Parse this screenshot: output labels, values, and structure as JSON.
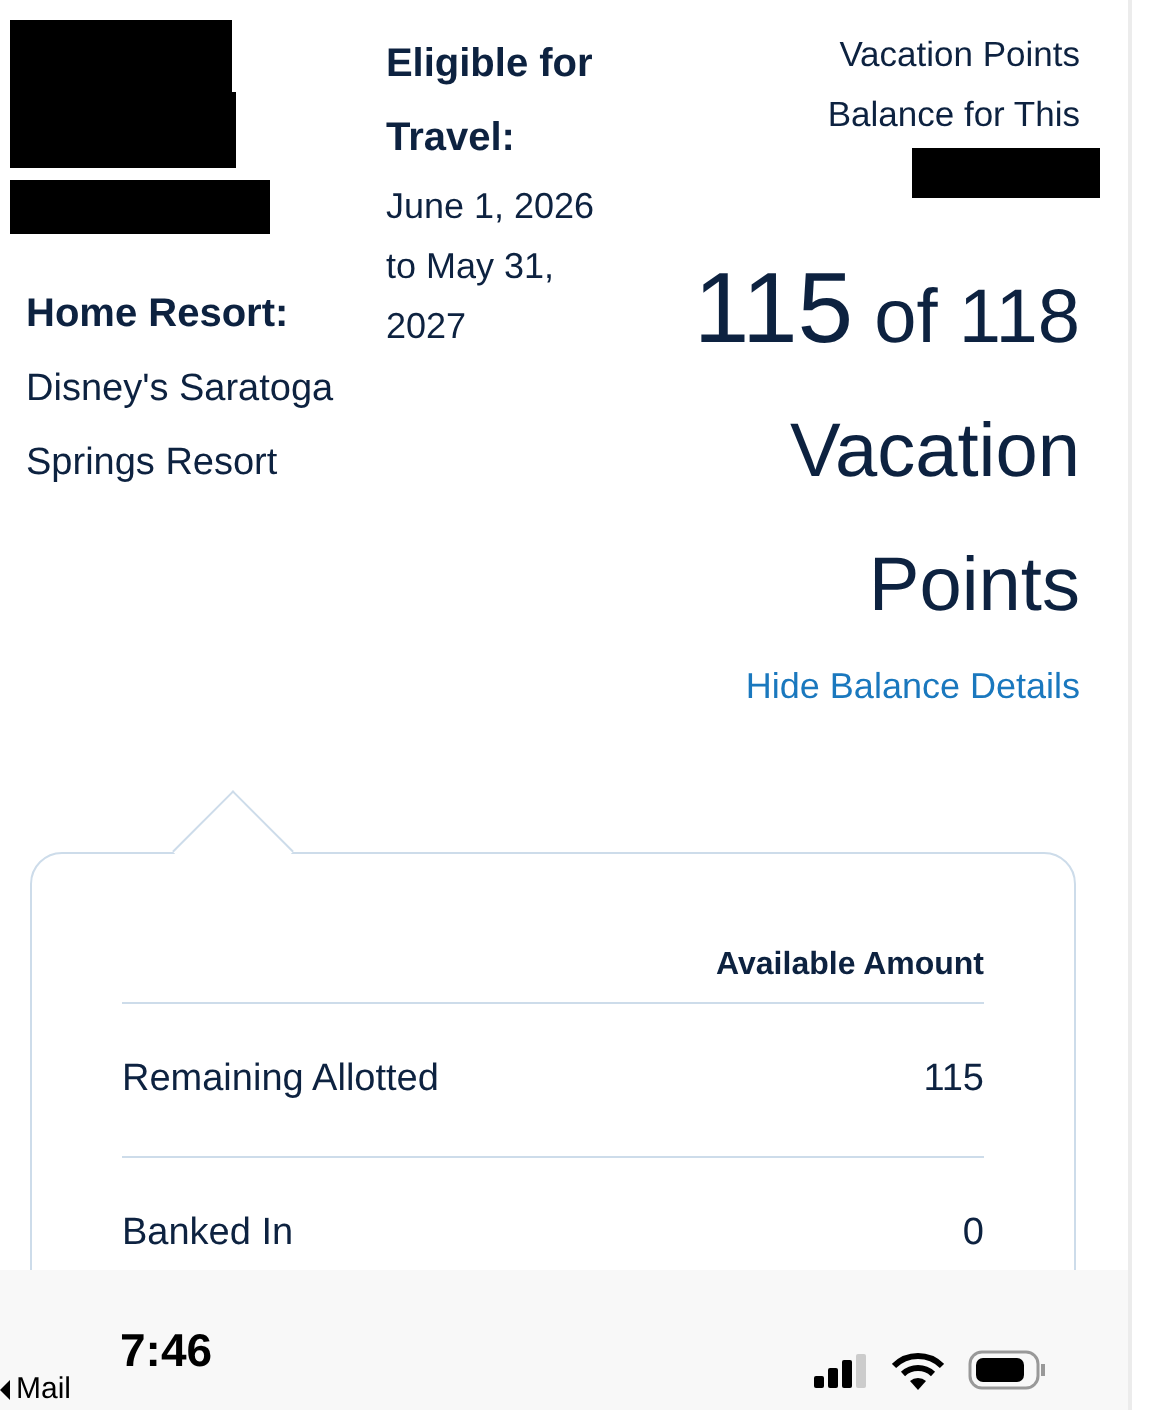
{
  "summary": {
    "home_resort": {
      "label": "Home Resort:",
      "value": "Disney's Saratoga Springs Resort"
    },
    "eligibility": {
      "label": "Eligible for Travel:",
      "dates": "June 1, 2026 to May 31, 2027"
    },
    "balance": {
      "caption": "Vacation Points Balance for This",
      "current": "115",
      "rest": "of 118 Vacation Points"
    },
    "toggle_link": "Hide Balance Details"
  },
  "details": {
    "columns": [
      "Available Amount"
    ],
    "rows": [
      {
        "label": "Remaining Allotted",
        "amount": "115"
      },
      {
        "label": "Banked In",
        "amount": "0"
      }
    ]
  },
  "status_bar": {
    "back_app": "Mail",
    "time": "7:46"
  }
}
